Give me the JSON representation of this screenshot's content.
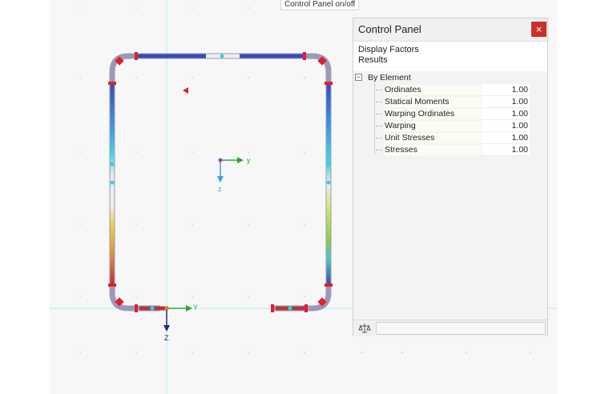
{
  "tooltip": "Control Panel on/off",
  "panel": {
    "title": "Control Panel",
    "close_label": "×",
    "sub1": "Display Factors",
    "sub2": "Results",
    "group": {
      "label": "By Element",
      "expander": "−"
    },
    "rows": [
      {
        "label": "Ordinates",
        "value": "1.00",
        "active": true
      },
      {
        "label": "Statical Moments",
        "value": "1.00"
      },
      {
        "label": "Warping Ordinates",
        "value": "1.00"
      },
      {
        "label": "Warping",
        "value": "1.00"
      },
      {
        "label": "Unit Stresses",
        "value": "1.00"
      },
      {
        "label": "Stresses",
        "value": "1.00"
      }
    ],
    "footer_icon": "balance-scale-icon"
  },
  "axes": {
    "center": {
      "y": "y",
      "z": "z"
    },
    "origin": {
      "y": "Y",
      "z": "Z"
    }
  },
  "colors": {
    "y_axis": "#2ea82e",
    "z_axis_center": "#3aa0e0",
    "z_axis_origin": "#1a2a8a",
    "support_marker": "#e0202a",
    "section_outline": "#8a8aa0",
    "close_button": "#c9302c"
  }
}
